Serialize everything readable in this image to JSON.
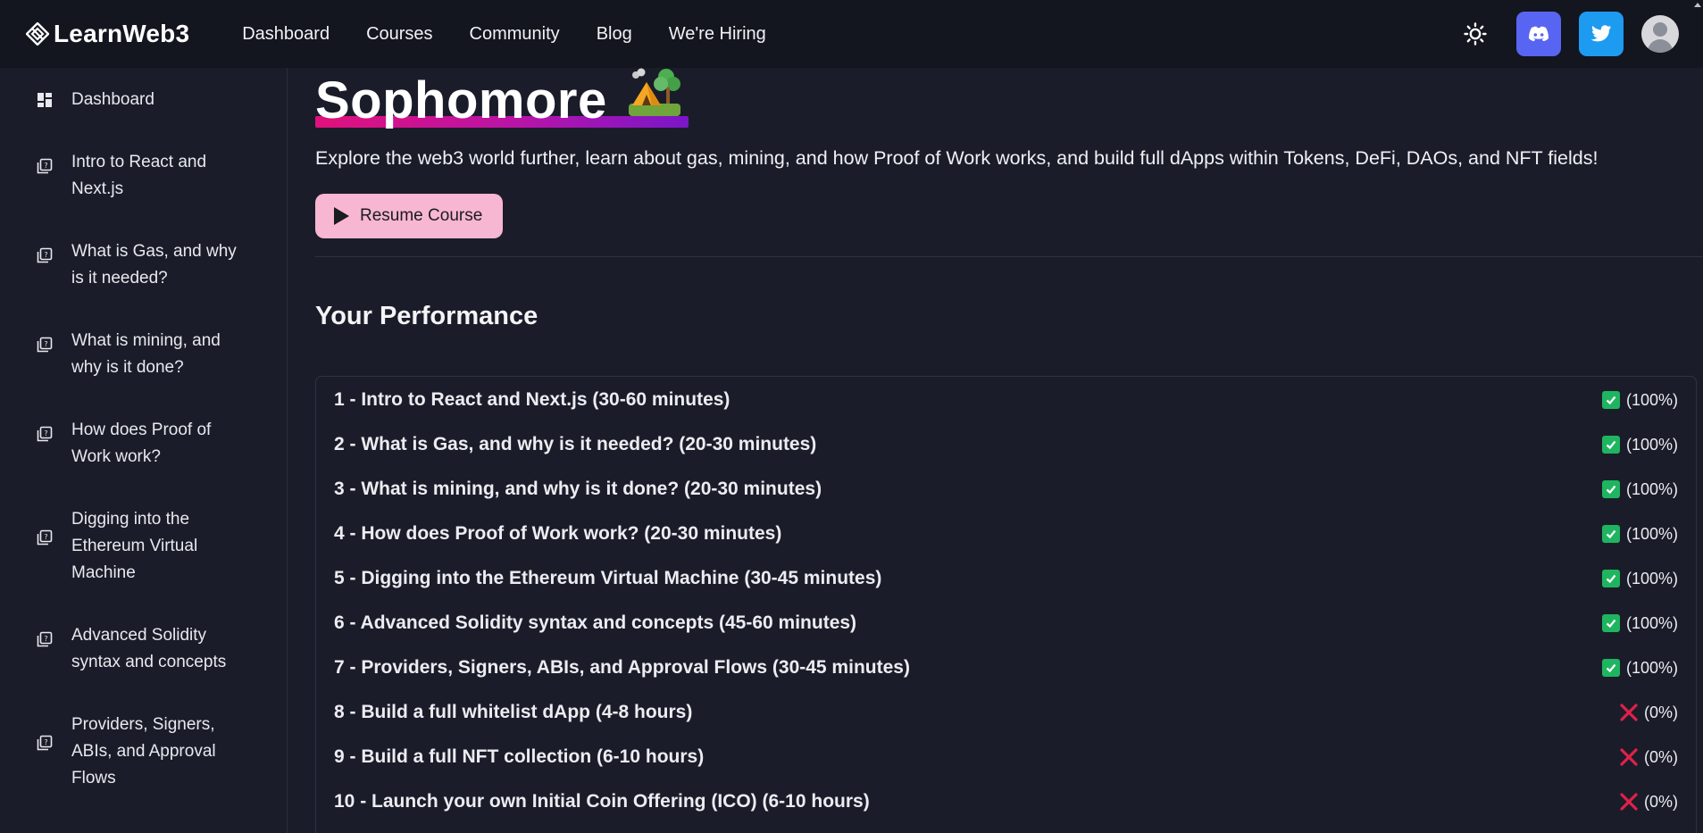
{
  "header": {
    "logo_text": "LearnWeb3",
    "nav": [
      "Dashboard",
      "Courses",
      "Community",
      "Blog",
      "We're Hiring"
    ],
    "discord_color": "#5865f2",
    "twitter_color": "#1d9bf0"
  },
  "sidebar": {
    "items": [
      {
        "label": "Dashboard",
        "icon": "dashboard-grid-icon"
      },
      {
        "label": "Intro to React and Next.js",
        "icon": "lesson-icon"
      },
      {
        "label": "What is Gas, and why is it needed?",
        "icon": "lesson-icon"
      },
      {
        "label": "What is mining, and why is it done?",
        "icon": "lesson-icon"
      },
      {
        "label": "How does Proof of Work work?",
        "icon": "lesson-icon"
      },
      {
        "label": "Digging into the Ethereum Virtual Machine",
        "icon": "lesson-icon"
      },
      {
        "label": "Advanced Solidity syntax and concepts",
        "icon": "lesson-icon"
      },
      {
        "label": "Providers, Signers, ABIs, and Approval Flows",
        "icon": "lesson-icon"
      }
    ]
  },
  "main": {
    "title": "Sophomore",
    "title_emoji": "camping-tent-icon",
    "subtitle": "Explore the web3 world further, learn about gas, mining, and how Proof of Work works, and build full dApps within Tokens, DeFi, DAOs, and NFT fields!",
    "resume_label": "Resume Course",
    "performance_title": "Your Performance",
    "performance": [
      {
        "name": "1 - Intro to React and Next.js (30-60 minutes)",
        "done": true,
        "percent": "(100%)"
      },
      {
        "name": "2 - What is Gas, and why is it needed? (20-30 minutes)",
        "done": true,
        "percent": "(100%)"
      },
      {
        "name": "3 - What is mining, and why is it done? (20-30 minutes)",
        "done": true,
        "percent": "(100%)"
      },
      {
        "name": "4 - How does Proof of Work work? (20-30 minutes)",
        "done": true,
        "percent": "(100%)"
      },
      {
        "name": "5 - Digging into the Ethereum Virtual Machine (30-45 minutes)",
        "done": true,
        "percent": "(100%)"
      },
      {
        "name": "6 - Advanced Solidity syntax and concepts (45-60 minutes)",
        "done": true,
        "percent": "(100%)"
      },
      {
        "name": "7 - Providers, Signers, ABIs, and Approval Flows (30-45 minutes)",
        "done": true,
        "percent": "(100%)"
      },
      {
        "name": "8 - Build a full whitelist dApp (4-8 hours)",
        "done": false,
        "percent": "(0%)"
      },
      {
        "name": "9 - Build a full NFT collection (6-10 hours)",
        "done": false,
        "percent": "(0%)"
      },
      {
        "name": "10 - Launch your own Initial Coin Offering (ICO) (6-10 hours)",
        "done": false,
        "percent": "(0%)"
      }
    ],
    "accent_gradient": [
      "#e0117c",
      "#7a16c8"
    ],
    "resume_color": "#f7b6d2",
    "success_color": "#1fb560",
    "fail_color": "#e0204a"
  }
}
